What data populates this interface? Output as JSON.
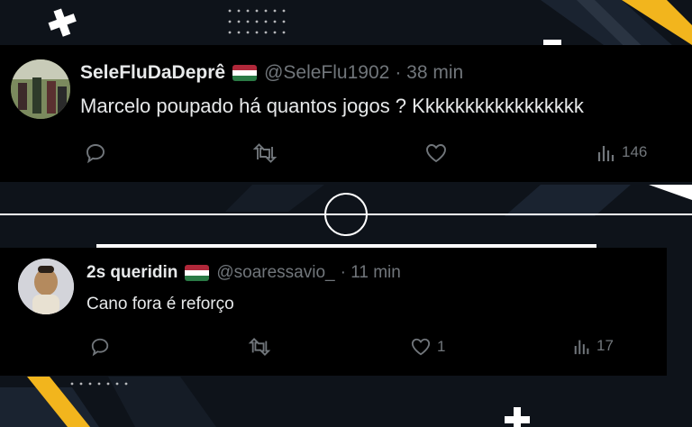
{
  "tweets": [
    {
      "name": "SeleFluDaDeprê",
      "handle": "@SeleFlu1902",
      "time": "· 38 min",
      "text": "Marcelo poupado há quantos jogos ? Kkkkkkkkkkkkkkkkk",
      "flag_colors": [
        "#8a1c2a",
        "#ffffff",
        "#1e6b3a"
      ],
      "actions": {
        "replies": "",
        "retweets": "",
        "likes": "",
        "views": "146"
      }
    },
    {
      "name": "2s queridin",
      "handle": "@soaressavio_",
      "time": "· 11 min",
      "text": "Cano fora é reforço",
      "flag_colors": [
        "#8a1c2a",
        "#ffffff",
        "#1e6b3a"
      ],
      "actions": {
        "replies": "",
        "retweets": "",
        "likes": "1",
        "views": "17"
      }
    }
  ],
  "icons": [
    "reply-icon",
    "retweet-icon",
    "like-icon",
    "views-icon"
  ],
  "colors": {
    "background": "#0e131a",
    "card": "#000000",
    "accent": "#f2b51d",
    "muted": "#71767b",
    "text": "#e7e9ea"
  }
}
